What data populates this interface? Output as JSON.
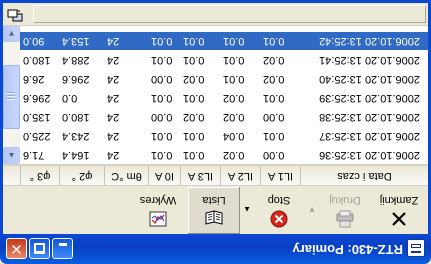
{
  "window": {
    "title": "RTZ-430: Pomiary",
    "orientation": "rotated 180 degrees",
    "min_label": "minimize",
    "max_label": "maximize",
    "close_glyph": "✕"
  },
  "toolbar": {
    "buttons": [
      {
        "label": "Zamknij",
        "icon": "close-x-icon",
        "state": "enabled"
      },
      {
        "label": "Drukuj",
        "icon": "printer-icon",
        "state": "disabled"
      },
      {
        "label": "Stop",
        "icon": "stop-icon",
        "state": "enabled"
      },
      {
        "label": "Lista",
        "icon": "list-book-icon",
        "state": "pressed"
      },
      {
        "label": "Wykres",
        "icon": "chart-icon",
        "state": "enabled"
      }
    ],
    "dropdown_glyph": "▼",
    "dropdown_glyph_up": "▲"
  },
  "table": {
    "columns": [
      "Data i czas",
      "IL1 A",
      "IL2 A",
      "IL3 A",
      "I0 A",
      "θm °C",
      "φ2 °",
      "φ3 °"
    ],
    "rows": [
      [
        "2006.10.20 13:25:36",
        "0.00",
        "0.02",
        "0.01",
        "0.01",
        "24",
        "164.4",
        "71.6"
      ],
      [
        "2006.10.20 13:25:37",
        "0.01",
        "0.04",
        "0.01",
        "0.01",
        "24",
        "243.4",
        "225.0"
      ],
      [
        "2006.10.20 13:25:38",
        "0.00",
        "0.02",
        "0.02",
        "0.00",
        "24",
        "180.0",
        "135.0"
      ],
      [
        "2006.10.20 13:25:39",
        "0.01",
        "0.02",
        "0.01",
        "0.01",
        "24",
        "0.0",
        "296.6"
      ],
      [
        "2006.10.20 13:25:40",
        "0.02",
        "0.01",
        "0.02",
        "0.00",
        "24",
        "296.6",
        "26.6"
      ],
      [
        "2006.10.20 13:25:41",
        "0.02",
        "0.01",
        "0.01",
        "0.01",
        "24",
        "288.4",
        "180.0"
      ],
      [
        "2006.10.20 13:25:42",
        "0.01",
        "0.01",
        "0.01",
        "0.01",
        "24",
        "153.4",
        "90.0"
      ]
    ],
    "selected_row": 6
  },
  "scrollbar": {
    "up_glyph": "▲",
    "down_glyph": "▼",
    "position_fraction": 0.45
  },
  "statusbar": {
    "icon": "network-computer-icon"
  },
  "colors": {
    "titlebar": "#0a3fc4",
    "selection": "#316ac5",
    "stop_red": "#d8261a",
    "face": "#ece9d8"
  }
}
